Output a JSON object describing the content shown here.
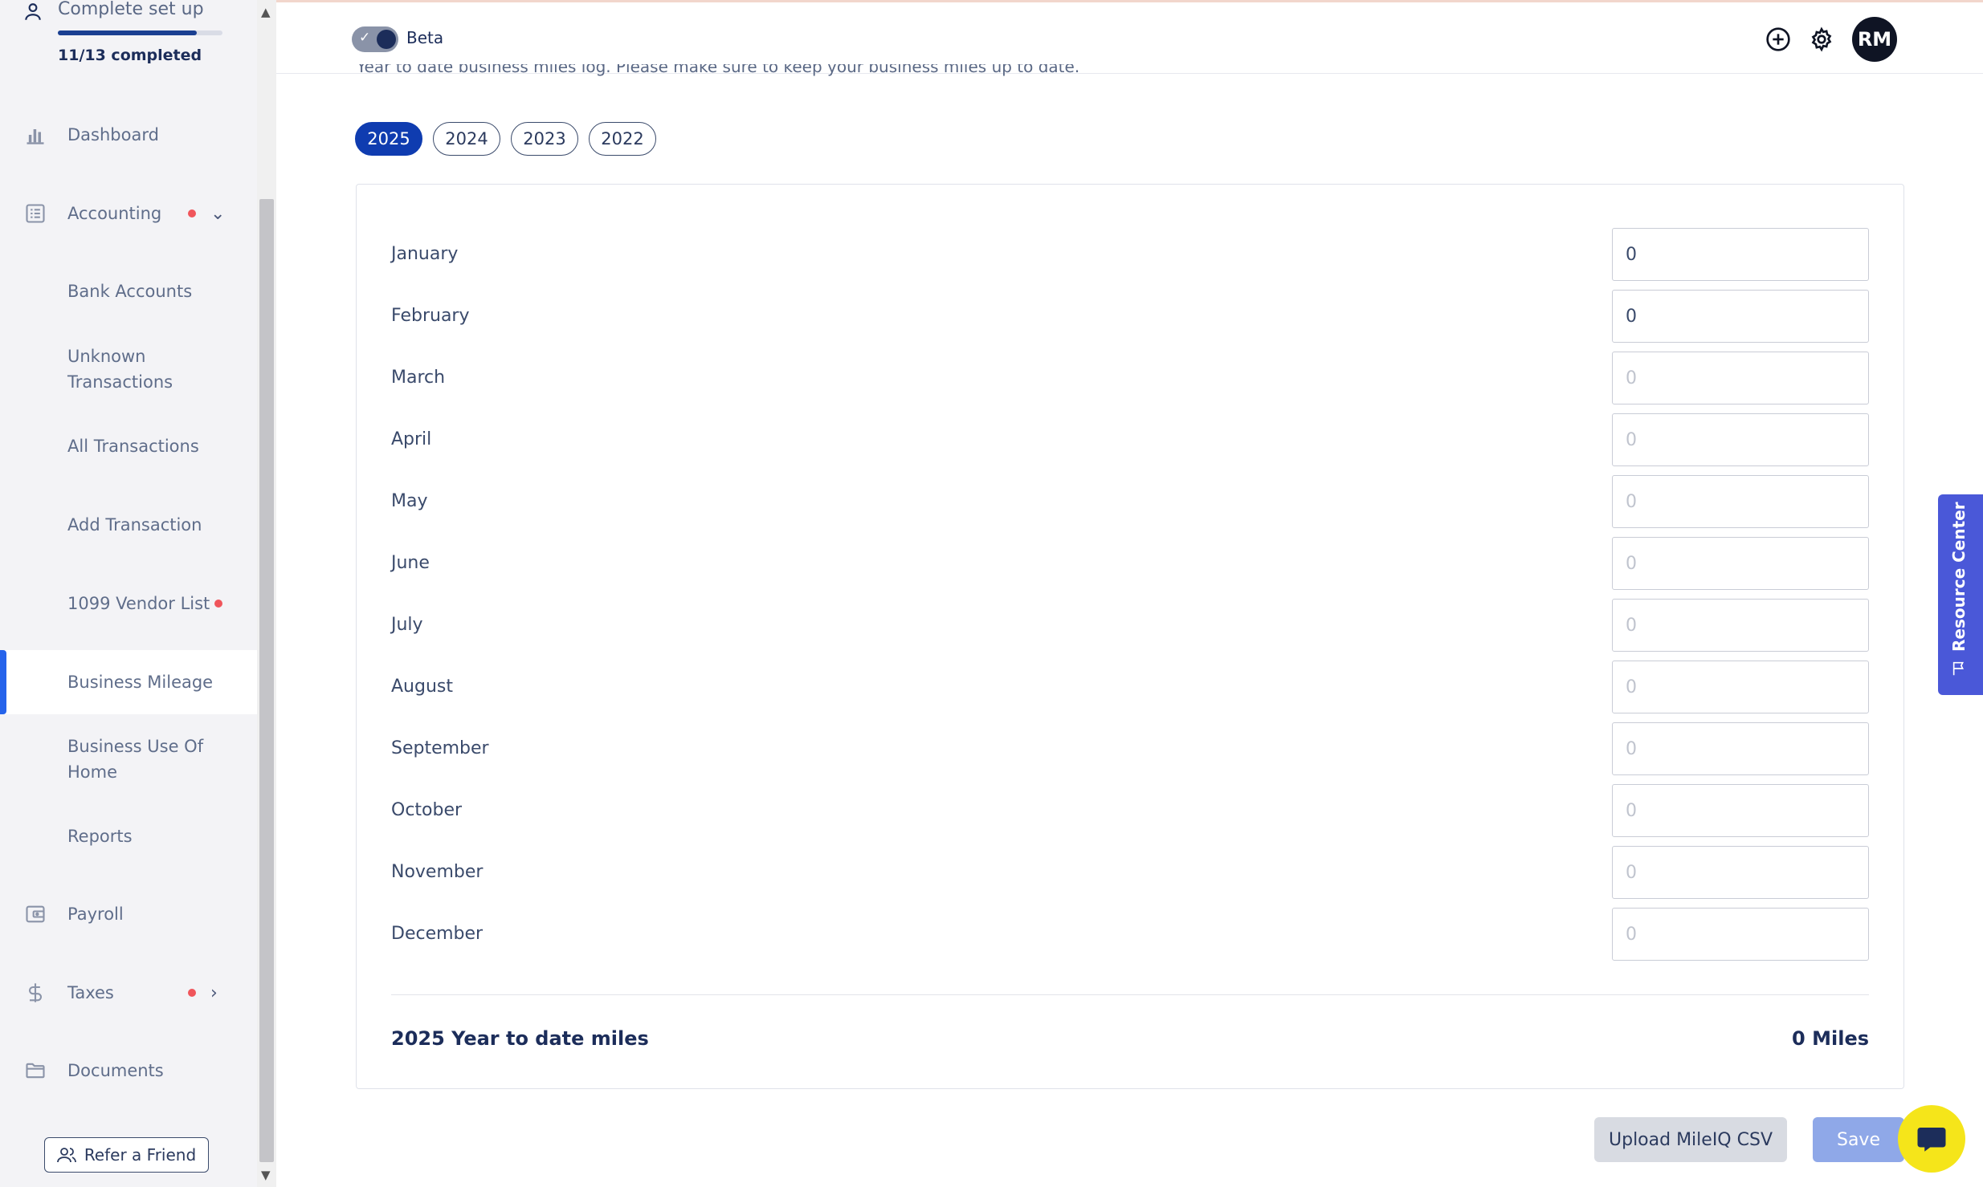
{
  "setup": {
    "title": "Complete set up",
    "progress_text": "11/13 completed",
    "progress_fraction": 0.846
  },
  "sidebar": {
    "items": [
      {
        "label": "Dashboard",
        "icon": "bar-chart-icon"
      },
      {
        "label": "Accounting",
        "icon": "ledger-icon",
        "alert": true,
        "expanded": true
      },
      {
        "label": "Bank Accounts"
      },
      {
        "label": "Unknown Transactions"
      },
      {
        "label": "All Transactions"
      },
      {
        "label": "Add Transaction"
      },
      {
        "label": "1099 Vendor List",
        "alert": true
      },
      {
        "label": "Business Mileage",
        "active": true
      },
      {
        "label": "Business Use Of Home"
      },
      {
        "label": "Reports"
      },
      {
        "label": "Payroll",
        "icon": "wallet-icon"
      },
      {
        "label": "Taxes",
        "icon": "dollar-icon",
        "alert": true
      },
      {
        "label": "Documents",
        "icon": "folder-icon"
      }
    ],
    "refer_label": "Refer a Friend"
  },
  "header": {
    "beta_label": "Beta",
    "beta_enabled": true,
    "avatar_initials": "RM"
  },
  "main": {
    "intro_text": "Year to date business miles log. Please make sure to keep your business miles up to date.",
    "years": [
      "2025",
      "2024",
      "2023",
      "2022"
    ],
    "selected_year": "2025",
    "months": [
      {
        "label": "January",
        "value": "0",
        "placeholder": "0"
      },
      {
        "label": "February",
        "value": "0",
        "placeholder": "0"
      },
      {
        "label": "March",
        "value": "",
        "placeholder": "0"
      },
      {
        "label": "April",
        "value": "",
        "placeholder": "0"
      },
      {
        "label": "May",
        "value": "",
        "placeholder": "0"
      },
      {
        "label": "June",
        "value": "",
        "placeholder": "0"
      },
      {
        "label": "July",
        "value": "",
        "placeholder": "0"
      },
      {
        "label": "August",
        "value": "",
        "placeholder": "0"
      },
      {
        "label": "September",
        "value": "",
        "placeholder": "0"
      },
      {
        "label": "October",
        "value": "",
        "placeholder": "0"
      },
      {
        "label": "November",
        "value": "",
        "placeholder": "0"
      },
      {
        "label": "December",
        "value": "",
        "placeholder": "0"
      }
    ],
    "total_label": "2025 Year to date miles",
    "total_value": "0 Miles",
    "upload_label": "Upload MileIQ CSV",
    "save_label": "Save"
  },
  "resource_center": {
    "label": "Resource Center"
  },
  "colors": {
    "brand_blue": "#0f3cb0",
    "active_indicator": "#2563eb",
    "alert_dot": "#f0555b",
    "resource_purple": "#4a58d8",
    "chat_yellow": "#f5e51a"
  }
}
